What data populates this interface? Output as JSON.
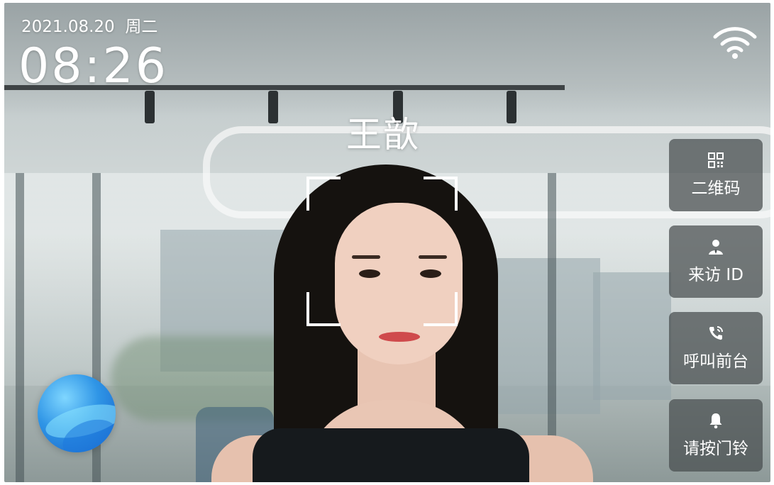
{
  "status": {
    "date": "2021.08.20",
    "weekday": "周二",
    "time": "08:26",
    "wifi_icon": "wifi-icon"
  },
  "recognition": {
    "name": "王歆"
  },
  "side_buttons": [
    {
      "icon": "qr-code-icon",
      "label": "二维码"
    },
    {
      "icon": "visitor-icon",
      "label": "来访 ID"
    },
    {
      "icon": "phone-call-icon",
      "label": "呼叫前台"
    },
    {
      "icon": "bell-icon",
      "label": "请按门铃"
    }
  ],
  "assistant": {
    "icon": "voice-assistant-icon"
  },
  "colors": {
    "button_bg": "#464c4e",
    "text": "#ffffff",
    "assistant": "#2f95e6"
  }
}
